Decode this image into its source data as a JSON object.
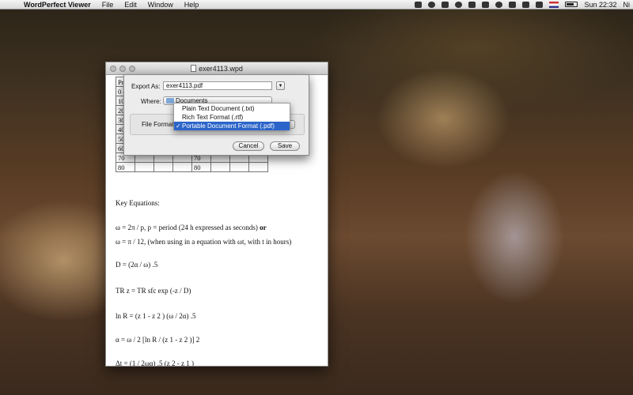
{
  "menubar": {
    "app_name": "WordPerfect Viewer",
    "items": [
      "File",
      "Edit",
      "Window",
      "Help"
    ],
    "clock": "Sun 22:32",
    "user": "Ni"
  },
  "window": {
    "title": "exer4113.wpd"
  },
  "document": {
    "table_rows": [
      [
        "Pr",
        "",
        "",
        "",
        "",
        "",
        "",
        ""
      ],
      [
        "0 c",
        "",
        "",
        "",
        "",
        "",
        "",
        ""
      ],
      [
        "10",
        "",
        "",
        "",
        "",
        "",
        "",
        ""
      ],
      [
        "20",
        "",
        "",
        "",
        "",
        "",
        "",
        ""
      ],
      [
        "30",
        "",
        "",
        "",
        "",
        "",
        "",
        ""
      ],
      [
        "40",
        "",
        "",
        "",
        "",
        "",
        "",
        ""
      ],
      [
        "50",
        "",
        "",
        "",
        "",
        "",
        "",
        ""
      ],
      [
        "60",
        "",
        "",
        "",
        "60",
        "",
        "",
        ""
      ],
      [
        "70",
        "",
        "",
        "",
        "70",
        "",
        "",
        ""
      ],
      [
        "80",
        "",
        "",
        "",
        "80",
        "",
        "",
        ""
      ]
    ],
    "heading": "Key Equations:",
    "eq1_a": "ω = 2π / p,       p = period (24 h expressed as seconds) ",
    "eq1_or": "or",
    "eq2": "ω = π / 12,       (when using in a equation with ωt, with t in hours)",
    "eq3": "D = (2α / ω) .5",
    "eq4": "TR z = TR sfc exp (-z / D)",
    "eq5": "ln R = (z 1 - z 2 ) (ω / 2α) .5",
    "eq6": "α = ω / 2 [ln R / (z 1 - z 2 )] 2",
    "eq7": "Δt = (1 / 2ωα) .5 (z 2 - z 1 )"
  },
  "export_sheet": {
    "export_as_label": "Export As:",
    "export_as_value": "exer4113.pdf",
    "where_label": "Where:",
    "where_value": "Documents",
    "file_format_label": "File Format",
    "cancel_label": "Cancel",
    "save_label": "Save"
  },
  "format_menu": {
    "options": [
      "Plain Text Document (.txt)",
      "Rich Text Format (.rtf)",
      "Portable Document Format (.pdf)"
    ],
    "check_mark": "✓"
  }
}
